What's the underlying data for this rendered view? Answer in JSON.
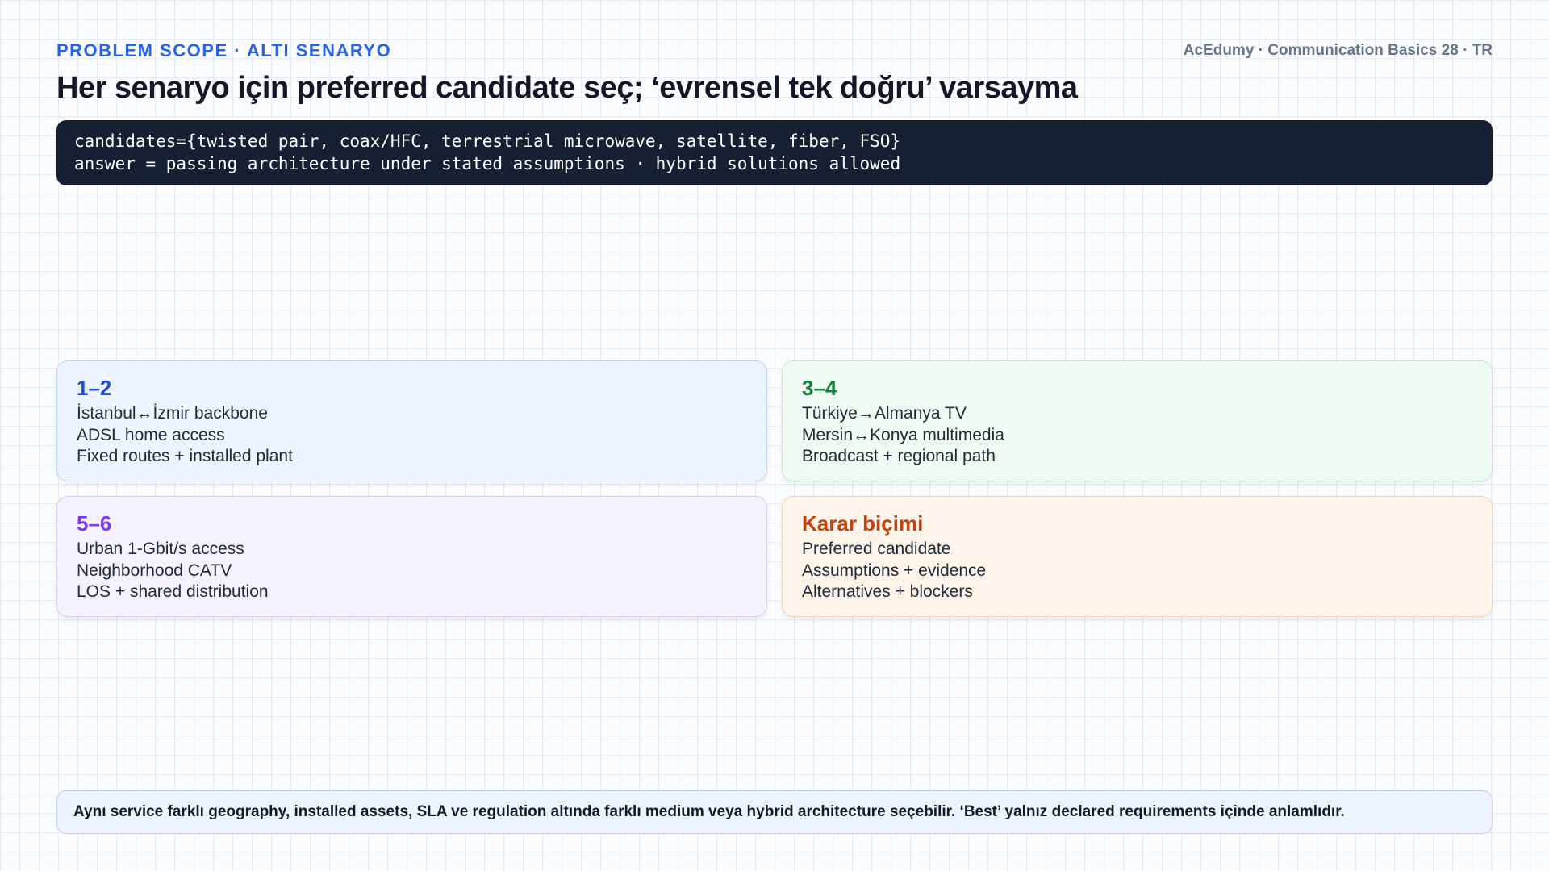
{
  "header": {
    "kicker": "PROBLEM SCOPE · ALTI SENARYO",
    "brand": "AcEdumy · Communication Basics 28 · TR"
  },
  "title": "Her senaryo için preferred candidate seç; ‘evrensel tek doğru’ varsayma",
  "code": {
    "line1": "candidates={twisted pair, coax/HFC, terrestrial microwave, satellite, fiber, FSO}",
    "line2": "answer = passing architecture under stated assumptions · hybrid solutions allowed"
  },
  "cards": [
    {
      "title": "1–2",
      "lines": [
        "İstanbul↔İzmir backbone",
        "ADSL home access",
        "Fixed routes + installed plant"
      ],
      "accent": "#1d4ed8"
    },
    {
      "title": "3–4",
      "lines": [
        "Türkiye→Almanya TV",
        "Mersin↔Konya multimedia",
        "Broadcast + regional path"
      ],
      "accent": "#15803d"
    },
    {
      "title": "5–6",
      "lines": [
        "Urban 1-Gbit/s access",
        "Neighborhood CATV",
        "LOS + shared distribution"
      ],
      "accent": "#7c3aed"
    },
    {
      "title": "Karar biçimi",
      "lines": [
        "Preferred candidate",
        "Assumptions + evidence",
        "Alternatives + blockers"
      ],
      "accent": "#c2410c"
    }
  ],
  "footer": "Aynı service farklı geography, installed assets, SLA ve regulation altında farklı medium veya hybrid architecture seçebilir. ‘Best’ yalnız declared requirements içinde anlamlıdır."
}
